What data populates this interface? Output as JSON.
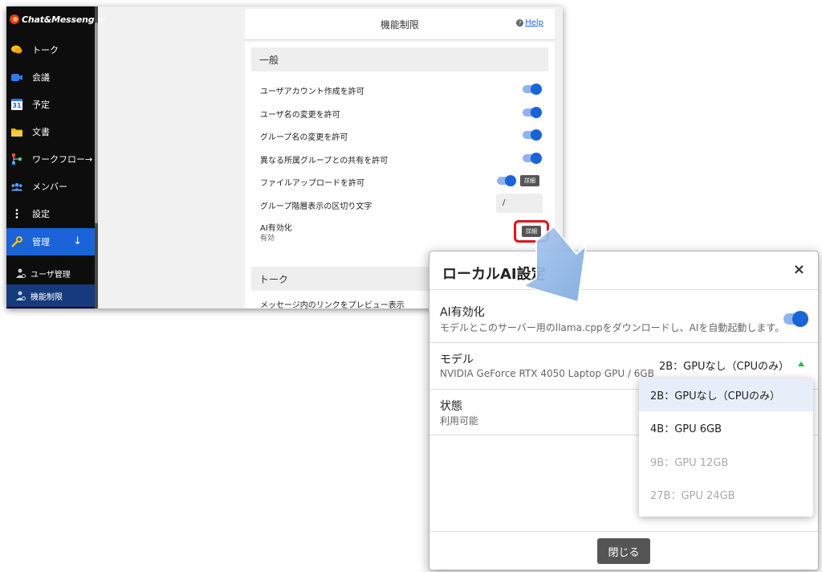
{
  "app": {
    "logo_text": "Chat&Messenger",
    "nav": [
      {
        "label": "トーク",
        "icon": "chat-bubble-icon"
      },
      {
        "label": "会議",
        "icon": "video-camera-icon"
      },
      {
        "label": "予定",
        "icon": "calendar-icon",
        "icon_text": "31"
      },
      {
        "label": "文書",
        "icon": "folder-icon"
      },
      {
        "label": "ワークフロー→",
        "icon": "workflow-icon"
      },
      {
        "label": "メンバー",
        "icon": "people-icon"
      },
      {
        "label": "設定",
        "icon": "more-vertical-icon"
      },
      {
        "label": "管理",
        "icon": "admin-tools-icon"
      }
    ],
    "nav_active_arrow": "↓",
    "sub_nav": [
      {
        "label": "ユーザ管理",
        "icon": "user-gear-icon"
      },
      {
        "label": "機能制限",
        "icon": "user-gear-icon"
      }
    ],
    "header": {
      "title": "機能制限",
      "help": "Help"
    },
    "sections": {
      "general_title": "一般",
      "rows": [
        {
          "label": "ユーザアカウント作成を許可",
          "toggle": true
        },
        {
          "label": "ユーザ名の変更を許可",
          "toggle": true
        },
        {
          "label": "グループ名の変更を許可",
          "toggle": true
        },
        {
          "label": "異なる所属グループとの共有を許可",
          "toggle": true
        },
        {
          "label": "ファイルアップロードを許可",
          "toggle": true,
          "detail": "詳細"
        },
        {
          "label": "グループ階層表示の区切り文字",
          "value": "/"
        },
        {
          "label": "AI有効化",
          "sub": "有効",
          "detail": "詳細"
        }
      ],
      "talk_title": "トーク",
      "talk_rows": [
        {
          "label": "メッセージ内のリンクをプレビュー表示"
        }
      ]
    }
  },
  "dialog": {
    "title": "ローカルAI設定",
    "close": "×",
    "ai": {
      "label": "AI有効化",
      "desc": "モデルとこのサーバー用のllama.cppをダウンロードし、AIを自動起動します。",
      "enabled": true
    },
    "model": {
      "label": "モデル",
      "desc": "NVIDIA GeForce RTX 4050 Laptop GPU / 6GB",
      "selected": "2B：GPUなし（CPUのみ）",
      "options": [
        {
          "label": "2B：GPUなし（CPUのみ）",
          "state": "selected"
        },
        {
          "label": "4B：GPU 6GB",
          "state": "enabled"
        },
        {
          "label": "9B：GPU 12GB",
          "state": "disabled"
        },
        {
          "label": "27B：GPU 24GB",
          "state": "disabled"
        }
      ]
    },
    "status": {
      "label": "状態",
      "value": "利用可能"
    },
    "close_button": "閉じる"
  },
  "colors": {
    "accent": "#1a63d8",
    "highlight": "#e0151a",
    "callout_arrow": "#8fb4e0"
  }
}
